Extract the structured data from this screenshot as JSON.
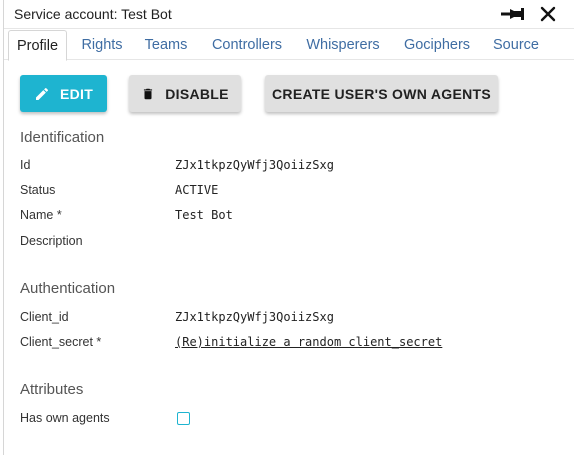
{
  "window": {
    "title": "Service account: Test Bot"
  },
  "tabs": [
    {
      "label": "Profile"
    },
    {
      "label": "Rights"
    },
    {
      "label": "Teams"
    },
    {
      "label": "Controllers"
    },
    {
      "label": "Whisperers"
    },
    {
      "label": "Gociphers"
    },
    {
      "label": "Source"
    }
  ],
  "toolbar": {
    "edit_label": "EDIT",
    "disable_label": "DISABLE",
    "create_agents_label": "CREATE USER'S OWN AGENTS"
  },
  "identification": {
    "heading": "Identification",
    "id_label": "Id",
    "id_value": "ZJx1tkpzQyWfj3QoiizSxg",
    "status_label": "Status",
    "status_value": "ACTIVE",
    "name_label": "Name *",
    "name_value": "Test Bot",
    "description_label": "Description"
  },
  "authentication": {
    "heading": "Authentication",
    "client_id_label": "Client_id",
    "client_id_value": "ZJx1tkpzQyWfj3QoiizSxg",
    "client_secret_label": "Client_secret *",
    "client_secret_link": "(Re)initialize a random client_secret"
  },
  "attributes": {
    "heading": "Attributes",
    "own_agents_label": "Has own agents",
    "own_agents_checked": false
  },
  "colors": {
    "accent": "#1eb4d0",
    "tab_link": "#3f6da3",
    "button_gray": "#e0e0e0"
  },
  "icons": {
    "pin": "pin-icon",
    "close": "close-icon",
    "edit": "pencil-icon",
    "disable": "trash-icon"
  }
}
